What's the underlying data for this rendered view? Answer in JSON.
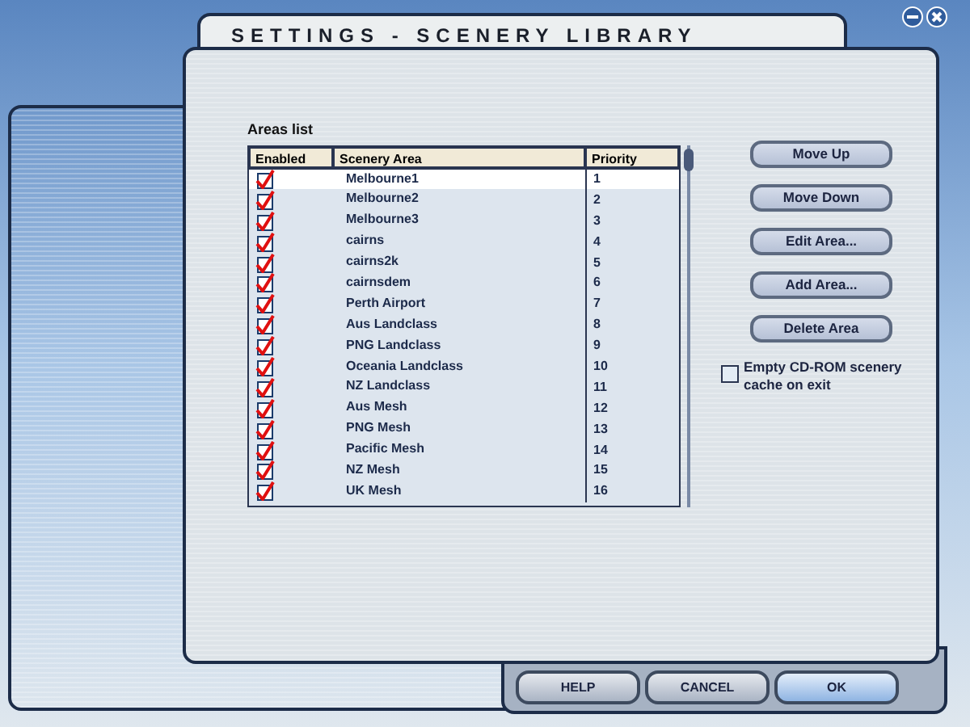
{
  "window": {
    "title": "SETTINGS - SCENERY LIBRARY"
  },
  "areas_list": {
    "label": "Areas list",
    "columns": [
      "Enabled",
      "Scenery Area",
      "Priority"
    ],
    "rows": [
      {
        "enabled": true,
        "name": "Melbourne1",
        "priority": "1",
        "selected": true
      },
      {
        "enabled": true,
        "name": "Melbourne2",
        "priority": "2",
        "selected": false
      },
      {
        "enabled": true,
        "name": "Melbourne3",
        "priority": "3",
        "selected": false
      },
      {
        "enabled": true,
        "name": "cairns",
        "priority": "4",
        "selected": false
      },
      {
        "enabled": true,
        "name": "cairns2k",
        "priority": "5",
        "selected": false
      },
      {
        "enabled": true,
        "name": "cairnsdem",
        "priority": "6",
        "selected": false
      },
      {
        "enabled": true,
        "name": "Perth Airport",
        "priority": "7",
        "selected": false
      },
      {
        "enabled": true,
        "name": "Aus Landclass",
        "priority": "8",
        "selected": false
      },
      {
        "enabled": true,
        "name": "PNG Landclass",
        "priority": "9",
        "selected": false
      },
      {
        "enabled": true,
        "name": "Oceania Landclass",
        "priority": "10",
        "selected": false
      },
      {
        "enabled": true,
        "name": "NZ Landclass",
        "priority": "11",
        "selected": false
      },
      {
        "enabled": true,
        "name": "Aus Mesh",
        "priority": "12",
        "selected": false
      },
      {
        "enabled": true,
        "name": "PNG Mesh",
        "priority": "13",
        "selected": false
      },
      {
        "enabled": true,
        "name": "Pacific Mesh",
        "priority": "14",
        "selected": false
      },
      {
        "enabled": true,
        "name": "NZ Mesh",
        "priority": "15",
        "selected": false
      },
      {
        "enabled": true,
        "name": "UK Mesh",
        "priority": "16",
        "selected": false
      }
    ]
  },
  "side_buttons": [
    "Move Up",
    "Move Down",
    "Edit Area...",
    "Add Area...",
    "Delete Area"
  ],
  "empty_cache": {
    "label": "Empty CD-ROM scenery cache on exit",
    "checked": false
  },
  "footer_buttons": [
    {
      "label": "HELP",
      "primary": false
    },
    {
      "label": "CANCEL",
      "primary": false
    },
    {
      "label": "OK",
      "primary": true
    }
  ]
}
